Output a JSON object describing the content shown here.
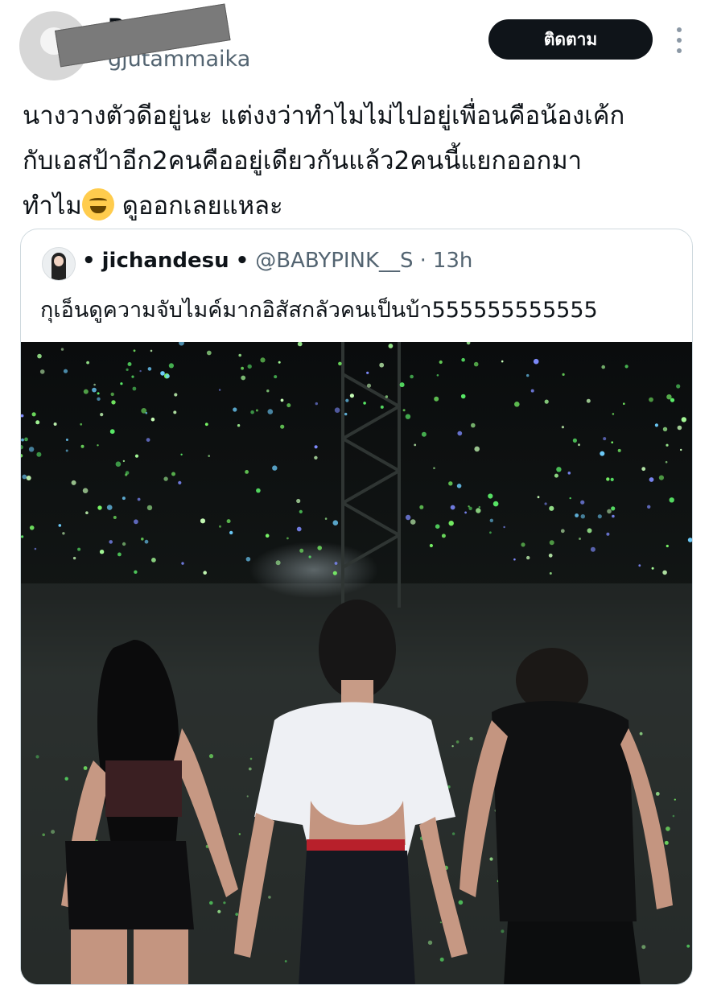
{
  "post": {
    "author": {
      "display_name": "Py",
      "handle": "gjutammaika"
    },
    "follow_label": "ติดตาม",
    "more_icon": "more-vertical-icon",
    "text_lines": [
      "นางวางตัวดีอยู่นะ แต่งงว่าทำไมไม่ไปอยู่เพื่อนคือน้องเค้ก",
      "กับเอสป้าอีก2คนคืออยู่เดียวกันแล้ว2คนนี้แยกออกมา",
      "ทำไม",
      " ดูออกเลยแหละ"
    ],
    "emoji": "grinning-face-with-sweat-icon"
  },
  "quote": {
    "bullet": "•",
    "display_name": "jichandesu",
    "name_suffix": "•",
    "handle": "@BABYPINK__S",
    "separator": "·",
    "time": "13h",
    "text": "กุเอ็นดูความจับไมค์มากอิสัสกลัวคนเป็นบ้า555555555555"
  },
  "colors": {
    "follow_bg": "#0f1419",
    "secondary_text": "#536471",
    "card_border": "#cfd9de"
  }
}
